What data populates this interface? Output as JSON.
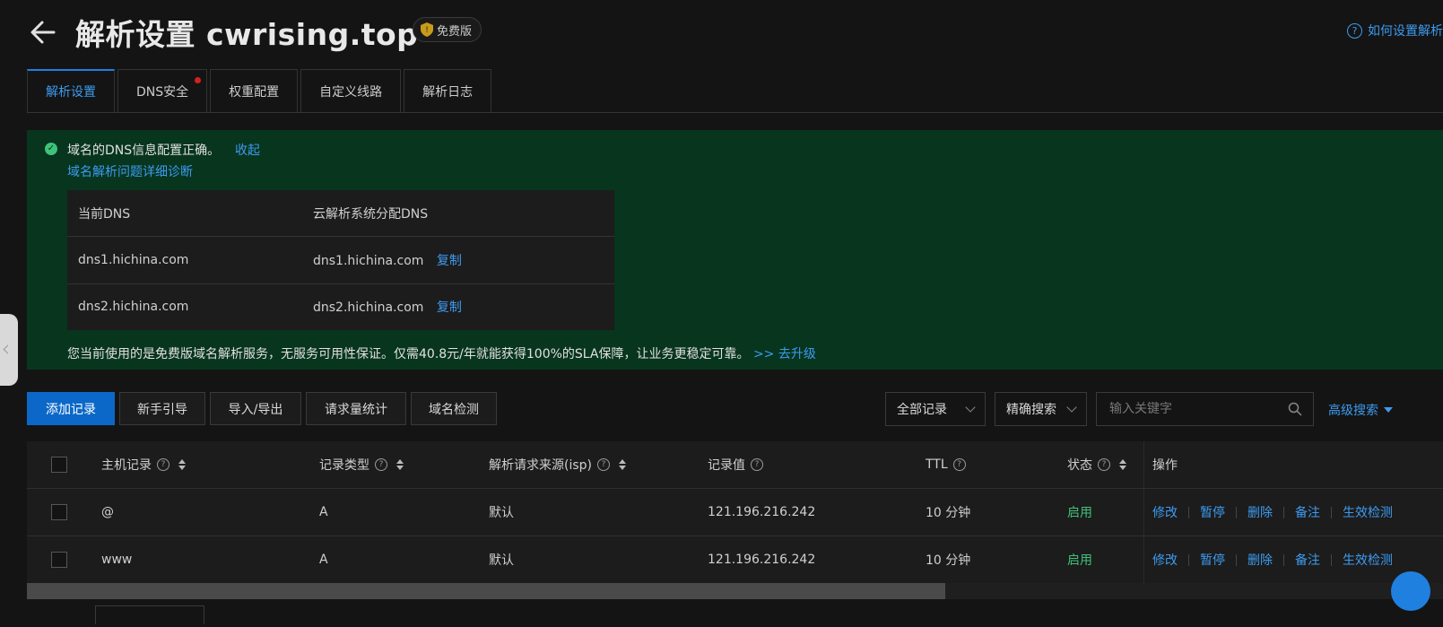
{
  "header": {
    "title": "解析设置 cwrising.top",
    "badge": "免费版",
    "help": "如何设置解析"
  },
  "tabs": [
    {
      "label": "解析设置"
    },
    {
      "label": "DNS安全"
    },
    {
      "label": "权重配置"
    },
    {
      "label": "自定义线路"
    },
    {
      "label": "解析日志"
    }
  ],
  "notice": {
    "status": "域名的DNS信息配置正确。",
    "collapse": "收起",
    "diagnose": "域名解析问题详细诊断",
    "table": {
      "headers": [
        "当前DNS",
        "云解析系统分配DNS"
      ],
      "rows": [
        [
          "dns1.hichina.com",
          "dns1.hichina.com"
        ],
        [
          "dns2.hichina.com",
          "dns2.hichina.com"
        ]
      ],
      "copy": "复制"
    },
    "upgrade_text": "您当前使用的是免费版域名解析服务，无服务可用性保证。仅需40.8元/年就能获得100%的SLA保障，让业务更稳定可靠。",
    "upgrade_link": ">> 去升级"
  },
  "toolbar": {
    "add": "添加记录",
    "guide": "新手引导",
    "import_export": "导入/导出",
    "stats": "请求量统计",
    "detect": "域名检测",
    "filter_all": "全部记录",
    "filter_mode": "精确搜索",
    "search_placeholder": "输入关键字",
    "advanced": "高级搜索"
  },
  "records": {
    "headers": [
      "主机记录",
      "记录类型",
      "解析请求来源(isp)",
      "记录值",
      "TTL",
      "状态",
      "操作"
    ],
    "rows": [
      {
        "host": "@",
        "type": "A",
        "isp": "默认",
        "value": "121.196.216.242",
        "ttl": "10 分钟",
        "status": "启用"
      },
      {
        "host": "www",
        "type": "A",
        "isp": "默认",
        "value": "121.196.216.242",
        "ttl": "10 分钟",
        "status": "启用"
      }
    ],
    "ops": [
      "修改",
      "暂停",
      "删除",
      "备注",
      "生效检测"
    ]
  },
  "colors": {
    "accent": "#1f80e0",
    "link": "#3d9bf0",
    "success": "#3fc27a",
    "notice_bg": "#07351e"
  }
}
